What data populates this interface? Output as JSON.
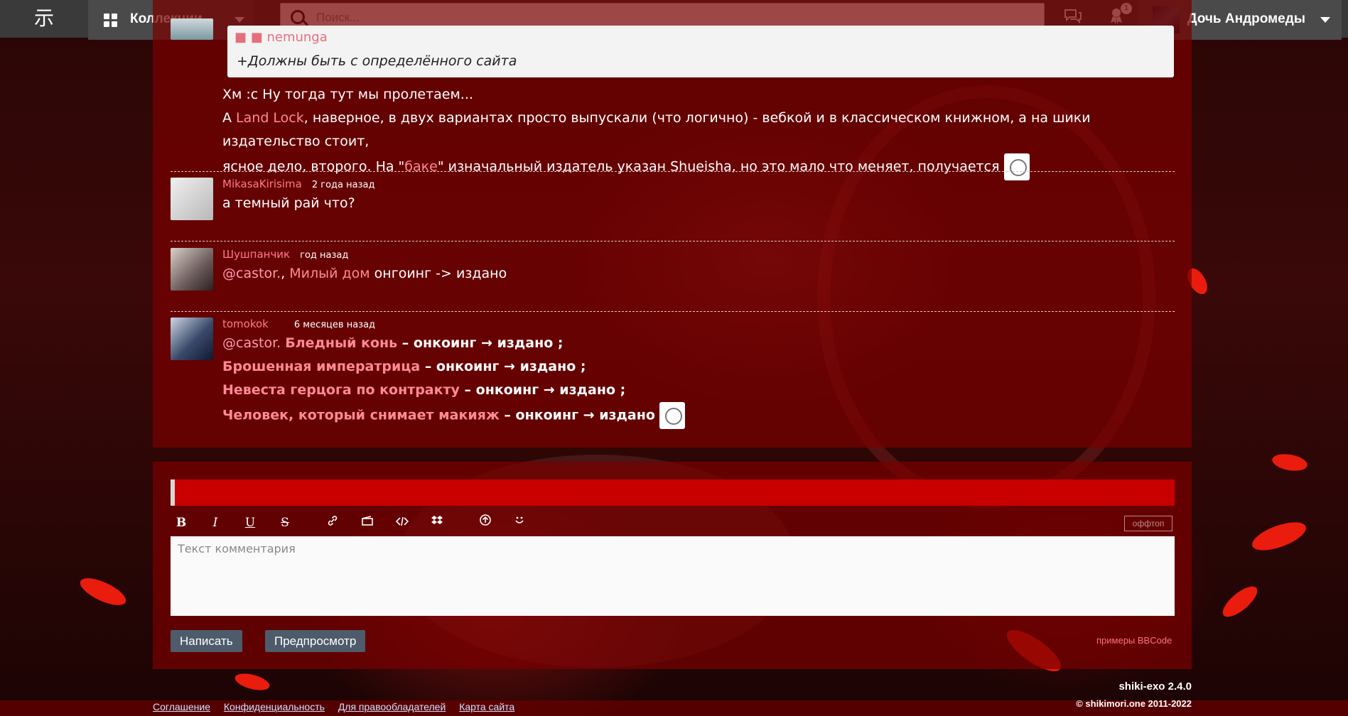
{
  "header": {
    "logo_glyph": "示",
    "collections_label": "Коллекции",
    "search_placeholder": "Поиск...",
    "notifications_count": "1",
    "user_name": "Дочь Андромеды"
  },
  "comments": {
    "quote": {
      "author": "nemunga",
      "text": "+Должны быть с определённого сайта"
    },
    "first_body": {
      "line1": "Хм :с Ну тогда тут мы пролетаем...",
      "line2_prefix": "А ",
      "line2_link": "Land Lock",
      "line2_suffix": ", наверное, в двух вариантах просто выпускали (что логично) - вебкой и в классическом книжном, а на шики издательство стоит,",
      "line3_prefix": "ясное дело, второго. На \"",
      "line3_link": "баке",
      "line3_suffix": "\" изначальный издатель указан Shueisha, но это мало что меняет, получается"
    },
    "items": [
      {
        "username": "MikasaKirisima",
        "time": "2 года назад",
        "text": "а темный рай что?"
      },
      {
        "username": "Шушпанчик",
        "time": "год назад",
        "mention": "@castor.",
        "sep": ", ",
        "link": "Милый дом",
        "text": " онгоинг -> издано"
      },
      {
        "username": "tomokok",
        "time": "6 месяцев назад",
        "mention": "@castor.",
        "lines": [
          {
            "link": "Бледный конь",
            "text": " – онкоинг → издано ;"
          },
          {
            "link": "Брошенная императрица",
            "text": " – онкоинг → издано ;"
          },
          {
            "link": "Невеста герцога по контракту",
            "text": " – онкоинг → издано ;"
          },
          {
            "link": "Человек, который снимает макияж",
            "text": " – онкоинг → издано"
          }
        ]
      }
    ]
  },
  "editor": {
    "toolbar": [
      "B",
      "I",
      "U",
      "S"
    ],
    "offtopic_label": "оффтоп",
    "textarea_placeholder": "Текст комментария",
    "submit_label": "Написать",
    "preview_label": "Предпросмотр",
    "bbcode_link": "примеры BBCode"
  },
  "footer": {
    "links": [
      "Соглашение",
      "Конфиденциальность",
      "Для правообладателей",
      "Карта сайта"
    ],
    "version": "shiki-exo 2.4.0",
    "copyright": "© shikimori.one 2011-2022"
  }
}
